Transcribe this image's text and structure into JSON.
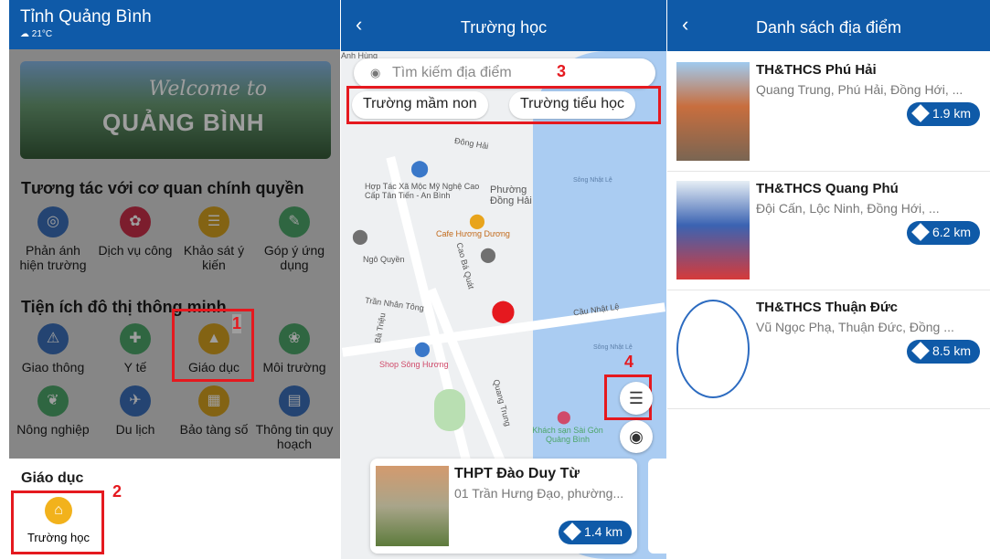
{
  "panel1": {
    "province": "Tỉnh Quảng Bình",
    "temperature": "21°C",
    "banner_line1": "Welcome to",
    "banner_line2": "QUẢNG BÌNH",
    "section1_title": "Tương tác với cơ quan chính quyền",
    "section1_items": [
      {
        "label": "Phản ánh hiện trường",
        "icon": "feedback-icon",
        "color": "#3a6fb8"
      },
      {
        "label": "Dịch vụ công",
        "icon": "public-service-icon",
        "color": "#c9304a"
      },
      {
        "label": "Khảo sát ý kiến",
        "icon": "survey-icon",
        "color": "#d4a020"
      },
      {
        "label": "Góp ý ứng dụng",
        "icon": "app-feedback-icon",
        "color": "#4da56a"
      }
    ],
    "section2_title": "Tiện ích đô thị thông minh",
    "section2_items": [
      {
        "label": "Giao thông",
        "icon": "traffic-icon",
        "color": "#3a6fb8"
      },
      {
        "label": "Y tế",
        "icon": "health-icon",
        "color": "#4da56a"
      },
      {
        "label": "Giáo dục",
        "icon": "education-icon",
        "color": "#d4a020"
      },
      {
        "label": "Môi trường",
        "icon": "environment-icon",
        "color": "#4da56a"
      },
      {
        "label": "Nông nghiệp",
        "icon": "agriculture-icon",
        "color": "#4da56a"
      },
      {
        "label": "Du lịch",
        "icon": "tourism-icon",
        "color": "#3a6fb8"
      },
      {
        "label": "Bảo tàng số",
        "icon": "museum-icon",
        "color": "#d4a020"
      },
      {
        "label": "Thông tin quy hoạch",
        "icon": "planning-icon",
        "color": "#3a6fb8"
      }
    ],
    "sub_title": "Giáo dục",
    "sub_item": "Trường học",
    "annotations": [
      "1",
      "2"
    ]
  },
  "panel2": {
    "title": "Trường học",
    "search_placeholder": "Tìm kiếm địa điểm",
    "chips": [
      "Trường mầm non",
      "Trường tiểu học"
    ],
    "annotations": [
      "3",
      "4"
    ],
    "map_labels": [
      "Đông Hải",
      "Hợp Tác Xã Mộc Mỹ Nghệ Cao Cấp Tân Tiến - An Bình",
      "Phường Đồng Hải",
      "Sông Nhật Lệ",
      "Cafe Hương Dương",
      "Ngô Quyền",
      "Cao Bá Quát",
      "Trần Nhân Tông",
      "Cầu Nhật Lệ",
      "Bà Triệu",
      "Shop Sông Hương",
      "Quang Trung",
      "Khách sạn Sài Gòn Quảng Bình",
      "Sông Nhật Lệ",
      "Anh Hùng"
    ],
    "card": {
      "name": "THPT Đào Duy Từ",
      "address": "01 Trần Hưng Đạo, phường...",
      "distance": "1.4 km"
    }
  },
  "panel3": {
    "title": "Danh sách địa điểm",
    "items": [
      {
        "name": "TH&THCS Phú Hải",
        "address": "Quang Trung, Phú Hải, Đồng Hới, ...",
        "distance": "1.9 km"
      },
      {
        "name": "TH&THCS Quang Phú",
        "address": "Đội Cấn, Lộc Ninh, Đồng Hới, ...",
        "distance": "6.2 km"
      },
      {
        "name": "TH&THCS Thuận Đức",
        "address": "Vũ Ngọc Phạ, Thuận Đức, Đồng ...",
        "distance": "8.5 km"
      }
    ]
  }
}
